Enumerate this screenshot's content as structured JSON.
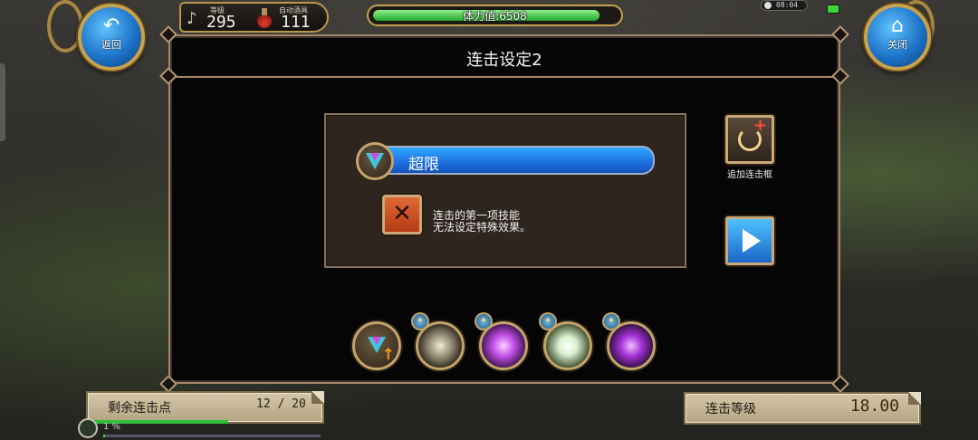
{
  "hud": {
    "level_label": "等级",
    "level_value": "295",
    "auto_potion_label": "自动酒具",
    "auto_potion_value": "111",
    "stamina_text": "体力值:6508",
    "stamina_fraction": 0.93,
    "clock": "08:04"
  },
  "nav": {
    "back_label": "返回",
    "close_label": "关闭"
  },
  "panel": {
    "title": "连击设定2",
    "skill_name": "超限",
    "warning_line1": "连击的第一项技能",
    "warning_line2": "无法设定特殊效果。",
    "add_frame_label": "追加连击框"
  },
  "skills": [
    {
      "icon": "prism-upgrade-icon"
    },
    {
      "icon": "barrier-skill-icon"
    },
    {
      "icon": "violet-wave-skill-icon"
    },
    {
      "icon": "light-arrow-skill-icon"
    },
    {
      "icon": "purple-lightning-skill-icon"
    }
  ],
  "bottom": {
    "points_label": "剩余连击点",
    "points_value": "12 / 20",
    "points_fraction": 0.6,
    "combo_level_label": "连击等级",
    "combo_level_value": "18.00",
    "exp_text": "1 %",
    "exp_fraction": 0.01
  },
  "colors": {
    "gold_frame": "#c4a46a",
    "skill_blue": "#1e6fe0",
    "stamina_green": "#25a72d"
  }
}
